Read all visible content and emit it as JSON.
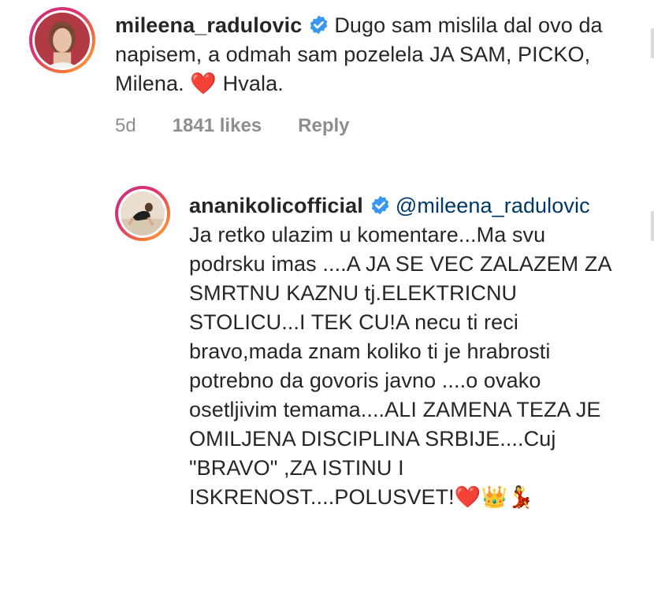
{
  "comments": [
    {
      "username": "mileena_radulovic",
      "verified": true,
      "text": "Dugo sam mislila dal ovo da napisem, a odmah sam pozelela JA SAM, PICKO, Milena. ❤️ Hvala.",
      "time": "5d",
      "likes": "1841 likes",
      "reply_label": "Reply"
    },
    {
      "username": "ananikolicofficial",
      "verified": true,
      "mention": "@mileena_radulovic",
      "text": "Ja retko ulazim u komentare...Ma svu podrsku imas ....A JA SE VEC ZALAZEM ZA SMRTNU KAZNU tj.ELEKTRICNU STOLICU...I TEK CU!A necu ti reci bravo,mada znam koliko ti je hrabrosti potrebno da govoris javno ....o ovako osetljivim temama....ALI ZAMENA TEZA JE OMILJENA DISCIPLINA SRBIJE....Cuj \"BRAVO\" ,ZA ISTINU I ISKRENOST....POLUSVET!❤️👑💃"
    }
  ],
  "colors": {
    "text": "#262626",
    "meta": "#8e8e8e",
    "verified_badge": "#3897f0",
    "mention": "#00376b"
  },
  "icons": {
    "verified": "verified-badge-icon"
  }
}
